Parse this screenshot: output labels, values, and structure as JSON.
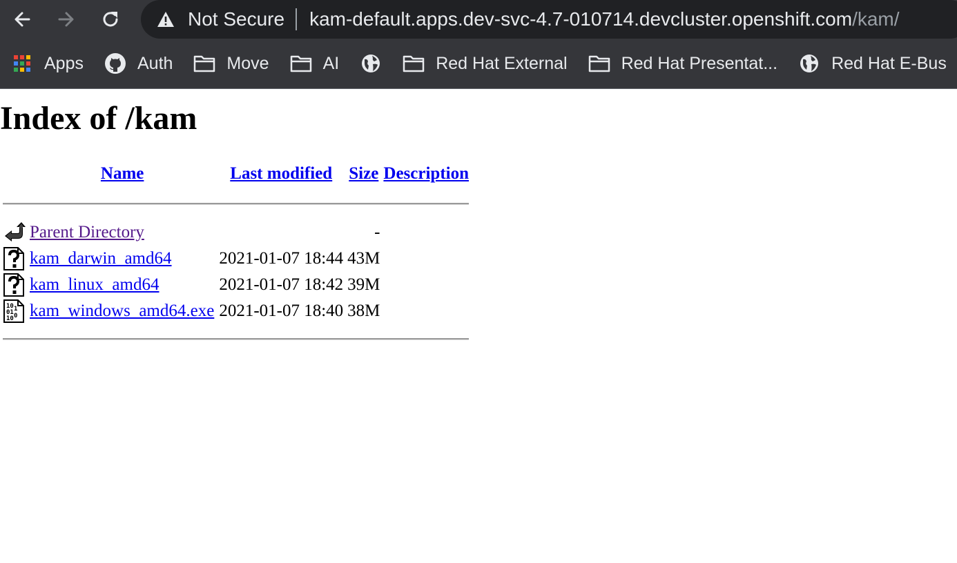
{
  "browser": {
    "toolbar": {
      "back_icon": "arrow-left-icon",
      "forward_icon": "arrow-right-icon",
      "reload_icon": "reload-icon"
    },
    "omnibox": {
      "security_icon": "warning-triangle-icon",
      "security_label": "Not Secure",
      "host": "kam-default.apps.dev-svc-4.7-010714.devcluster.openshift.com",
      "path": "/kam/"
    },
    "bookmarks": [
      {
        "label": "Apps",
        "icon": "apps-grid-icon"
      },
      {
        "label": "Auth",
        "icon": "github-icon"
      },
      {
        "label": "Move",
        "icon": "folder-icon"
      },
      {
        "label": "AI",
        "icon": "folder-icon"
      },
      {
        "label": "",
        "icon": "globe-icon"
      },
      {
        "label": "Red Hat External",
        "icon": "folder-icon"
      },
      {
        "label": "Red Hat Presentat...",
        "icon": "folder-icon"
      },
      {
        "label": "Red Hat E-Bus",
        "icon": "globe-icon"
      }
    ]
  },
  "page": {
    "title": "Index of /kam",
    "columns": {
      "name": "Name",
      "last_modified": "Last modified",
      "size": "Size",
      "description": "Description"
    },
    "entries": [
      {
        "name": "Parent Directory",
        "modified": "",
        "size": "-",
        "description": "",
        "icon": "back-arrow-icon"
      },
      {
        "name": "kam_darwin_amd64",
        "modified": "2021-01-07 18:44",
        "size": "43M",
        "description": "",
        "icon": "unknown-file-icon"
      },
      {
        "name": "kam_linux_amd64",
        "modified": "2021-01-07 18:42",
        "size": "39M",
        "description": "",
        "icon": "unknown-file-icon"
      },
      {
        "name": "kam_windows_amd64.exe",
        "modified": "2021-01-07 18:40",
        "size": "38M",
        "description": "",
        "icon": "binary-file-icon"
      }
    ]
  }
}
